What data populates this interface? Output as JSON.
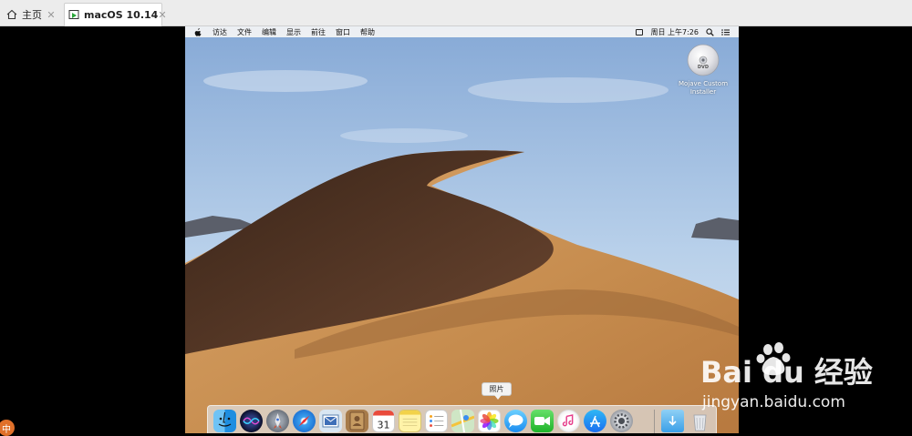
{
  "tabs": [
    {
      "label": "主页",
      "icon": "home-icon",
      "active": false
    },
    {
      "label": "macOS 10.14",
      "icon": "vm-icon",
      "active": true
    }
  ],
  "menubar": {
    "apple_icon": "apple-icon",
    "items": [
      "访达",
      "文件",
      "编辑",
      "显示",
      "前往",
      "窗口",
      "帮助"
    ],
    "clock": "周日 上午7:26"
  },
  "desktop_icon": {
    "label_line1": "Mojave Custom",
    "label_line2": "Installer",
    "disc_text": "DVD"
  },
  "tooltip": "照片",
  "dock": {
    "items": [
      {
        "name": "finder",
        "icon": "finder-icon"
      },
      {
        "name": "siri",
        "icon": "siri-icon"
      },
      {
        "name": "launchpad",
        "icon": "launchpad-icon"
      },
      {
        "name": "safari",
        "icon": "safari-icon"
      },
      {
        "name": "mail",
        "icon": "mail-icon"
      },
      {
        "name": "contacts",
        "icon": "contacts-icon"
      },
      {
        "name": "calendar",
        "icon": "calendar-icon",
        "text": "31"
      },
      {
        "name": "notes",
        "icon": "notes-icon"
      },
      {
        "name": "reminders",
        "icon": "reminders-icon"
      },
      {
        "name": "maps",
        "icon": "maps-icon"
      },
      {
        "name": "photos",
        "icon": "photos-icon"
      },
      {
        "name": "messages",
        "icon": "messages-icon"
      },
      {
        "name": "facetime",
        "icon": "facetime-icon"
      },
      {
        "name": "itunes",
        "icon": "itunes-icon"
      },
      {
        "name": "app-store",
        "icon": "app-store-icon"
      },
      {
        "name": "system-preferences",
        "icon": "gear-icon"
      },
      {
        "name": "downloads",
        "icon": "downloads-folder-icon"
      },
      {
        "name": "trash",
        "icon": "trash-icon"
      }
    ]
  },
  "overlay": {
    "ime_badge": "中",
    "watermark_brand": "Bai du 经验",
    "watermark_url": "jingyan.baidu.com"
  },
  "colors": {
    "accent_vm_tab": "#2aa63a",
    "sky": "#a9c6e6",
    "sand": "#c48a4b",
    "dune_shadow": "#5b3c28"
  }
}
